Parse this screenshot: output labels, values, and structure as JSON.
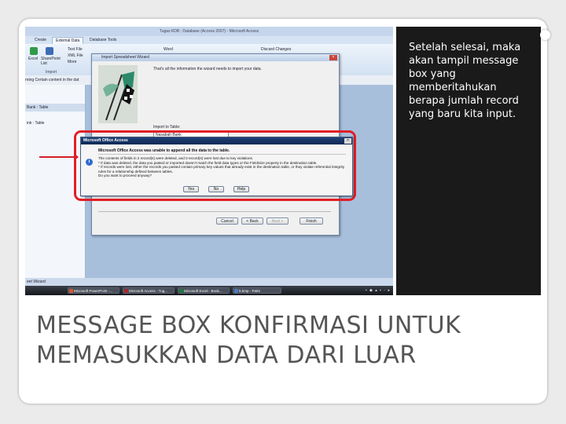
{
  "slide": {
    "caption": "Setelah selesai, maka akan tampil message box yang memberitahukan berapa jumlah record yang baru kita input.",
    "title": "MESSAGE BOX KONFIRMASI UNTUK MEMASUKKAN DATA DARI LUAR"
  },
  "access": {
    "window_title": "Tugas KDB : Database (Access 2007) - Microsoft Access",
    "tabs": [
      "Create",
      "External Data",
      "Database Tools"
    ],
    "ribbon": {
      "import_items": [
        "Excel",
        "SharePoint List",
        "Text File",
        "XML File",
        "More"
      ],
      "import_group": "Import",
      "word_label": "Word",
      "discard_label": "Discard Changes"
    },
    "message_bar": "rning   Certain content in the dat",
    "nav": {
      "header1": "Bank : Table",
      "item1": "ink : Table"
    },
    "status_bar": "eet Wizard",
    "taskbar": [
      {
        "label": "Microsoft PowerPoint -...",
        "color": "#d9572c"
      },
      {
        "label": "Microsoft Access - Tug...",
        "color": "#a8262e"
      },
      {
        "label": "Microsoft Excel - Book...",
        "color": "#1f7a3a"
      },
      {
        "label": "5.bmp - Paint",
        "color": "#4b7bc2"
      }
    ]
  },
  "wizard": {
    "title": "Import Spreadsheet Wizard",
    "message": "That's all the information the wizard needs to import your data.",
    "import_label": "Import to Table:",
    "import_value": "Nasabah Bank",
    "buttons": [
      "Cancel",
      "< Back",
      "Next >",
      "Finish"
    ]
  },
  "msgbox": {
    "title": "Microsoft Office Access",
    "heading": "Microsoft Office Access was unable to append all the data to the table.",
    "body": "The contents of fields in 2 record(s) were deleted, and 0 record(s) were lost due to key violations.\n* If data was deleted, the data you pasted or imported doesn't match the field data types or the FieldSize property in the destination table.\n* If records were lost, either the records you pasted contain primary key values that already exist in the destination table, or they violate referential integrity rules for a relationship defined between tables.\nDo you want to proceed anyway?",
    "buttons": {
      "yes": "Yes",
      "no": "No",
      "help": "Help"
    }
  }
}
